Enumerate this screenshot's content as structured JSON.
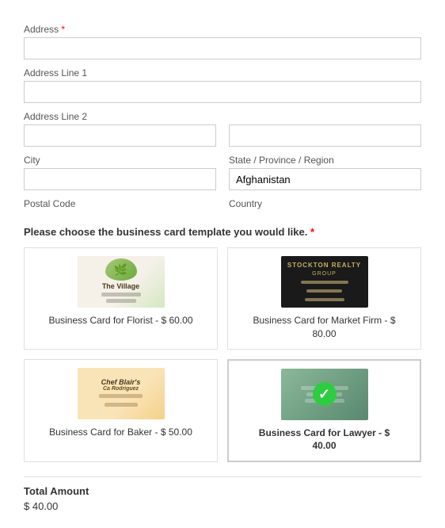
{
  "form": {
    "address_label": "Address",
    "address_line1_label": "Address Line 1",
    "address_line2_label": "Address Line 2",
    "city_label": "City",
    "state_label": "State / Province / Region",
    "postal_label": "Postal Code",
    "country_label": "Country",
    "country_value": "Afghanistan",
    "section_title": "Please choose the business card template you would like.",
    "cards": [
      {
        "id": "florist",
        "label": "Business Card for Florist - $ 60.00",
        "selected": false
      },
      {
        "id": "market",
        "label": "Business Card for Market Firm - $ 80.00",
        "selected": false
      },
      {
        "id": "baker",
        "label": "Business Card for Baker - $ 50.00",
        "selected": false
      },
      {
        "id": "lawyer",
        "label": "Business Card for Lawyer - $ 40.00",
        "selected": true
      }
    ],
    "total_label": "Total Amount",
    "total_value": "$ 40.00"
  }
}
